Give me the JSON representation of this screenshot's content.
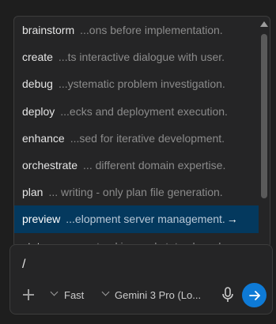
{
  "commands": [
    {
      "name": "brainstorm",
      "desc": "...ons before implementation."
    },
    {
      "name": "create",
      "desc": "...ts interactive dialogue with user."
    },
    {
      "name": "debug",
      "desc": "...ystematic problem investigation."
    },
    {
      "name": "deploy",
      "desc": "...ecks and deployment execution."
    },
    {
      "name": "enhance",
      "desc": "...sed for iterative development."
    },
    {
      "name": "orchestrate",
      "desc": "... different domain expertise."
    },
    {
      "name": "plan",
      "desc": "... writing - only plan file generation."
    },
    {
      "name": "preview",
      "desc": "...elopment server management.",
      "selected": true,
      "arrow": "→"
    },
    {
      "name": "status",
      "desc": "...gress tracking and status board."
    }
  ],
  "input": {
    "value": "/"
  },
  "toolbar": {
    "add_icon": "plus-icon",
    "mode_label": "Fast",
    "model_label": "Gemini 3 Pro (Lo...",
    "mic_icon": "microphone-icon",
    "send_icon": "arrow-right-icon"
  },
  "colors": {
    "background": "#1e1e1e",
    "panel": "#252526",
    "selected": "#04395e",
    "accent": "#0e7ad6"
  }
}
